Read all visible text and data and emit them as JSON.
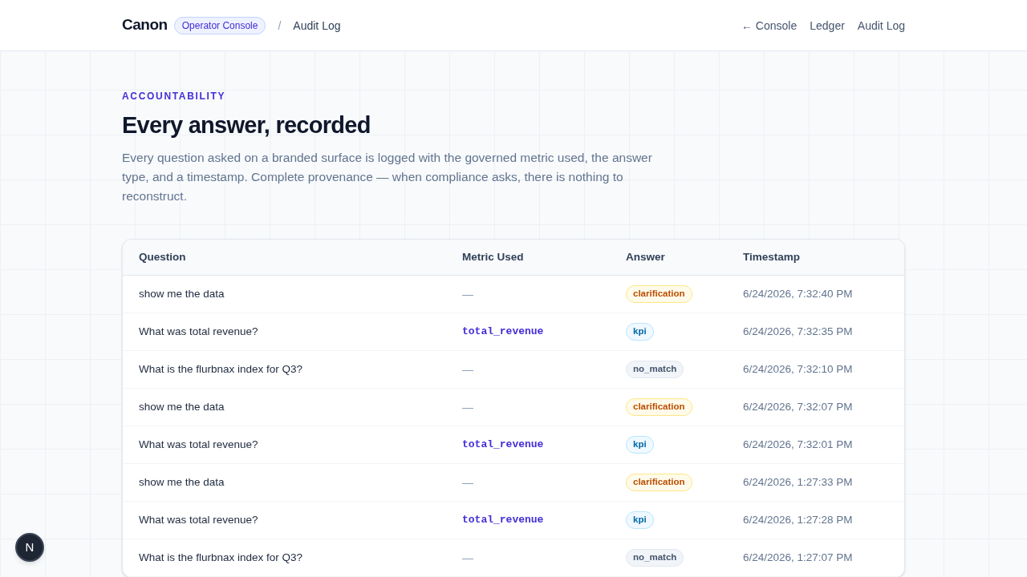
{
  "header": {
    "brand": "Canon",
    "badge": "Operator Console",
    "separator": "/",
    "page": "Audit Log",
    "nav": [
      {
        "label": "← Console"
      },
      {
        "label": "Ledger"
      },
      {
        "label": "Audit Log"
      }
    ]
  },
  "intro": {
    "eyebrow": "ACCOUNTABILITY",
    "title": "Every answer, recorded",
    "description": "Every question asked on a branded surface is logged with the governed metric used, the answer type, and a timestamp. Complete provenance — when compliance asks, there is nothing to reconstruct."
  },
  "table": {
    "columns": [
      "Question",
      "Metric Used",
      "Answer",
      "Timestamp"
    ],
    "rows": [
      {
        "question": "show me the data",
        "metric": {
          "kind": "none",
          "text": "—"
        },
        "answer": {
          "kind": "clarification",
          "label": "clarification"
        },
        "timestamp": "6/24/2026, 7:32:40 PM"
      },
      {
        "question": "What was total revenue?",
        "metric": {
          "kind": "metric",
          "text": "total_revenue"
        },
        "answer": {
          "kind": "kpi",
          "label": "kpi"
        },
        "timestamp": "6/24/2026, 7:32:35 PM"
      },
      {
        "question": "What is the flurbnax index for Q3?",
        "metric": {
          "kind": "none",
          "text": "—"
        },
        "answer": {
          "kind": "no_match",
          "label": "no_match"
        },
        "timestamp": "6/24/2026, 7:32:10 PM"
      },
      {
        "question": "show me the data",
        "metric": {
          "kind": "none",
          "text": "—"
        },
        "answer": {
          "kind": "clarification",
          "label": "clarification"
        },
        "timestamp": "6/24/2026, 7:32:07 PM"
      },
      {
        "question": "What was total revenue?",
        "metric": {
          "kind": "metric",
          "text": "total_revenue"
        },
        "answer": {
          "kind": "kpi",
          "label": "kpi"
        },
        "timestamp": "6/24/2026, 7:32:01 PM"
      },
      {
        "question": "show me the data",
        "metric": {
          "kind": "none",
          "text": "—"
        },
        "answer": {
          "kind": "clarification",
          "label": "clarification"
        },
        "timestamp": "6/24/2026, 1:27:33 PM"
      },
      {
        "question": "What was total revenue?",
        "metric": {
          "kind": "metric",
          "text": "total_revenue"
        },
        "answer": {
          "kind": "kpi",
          "label": "kpi"
        },
        "timestamp": "6/24/2026, 1:27:28 PM"
      },
      {
        "question": "What is the flurbnax index for Q3?",
        "metric": {
          "kind": "none",
          "text": "—"
        },
        "answer": {
          "kind": "no_match",
          "label": "no_match"
        },
        "timestamp": "6/24/2026, 1:27:07 PM"
      }
    ]
  },
  "dev_indicator": {
    "label": "N"
  }
}
